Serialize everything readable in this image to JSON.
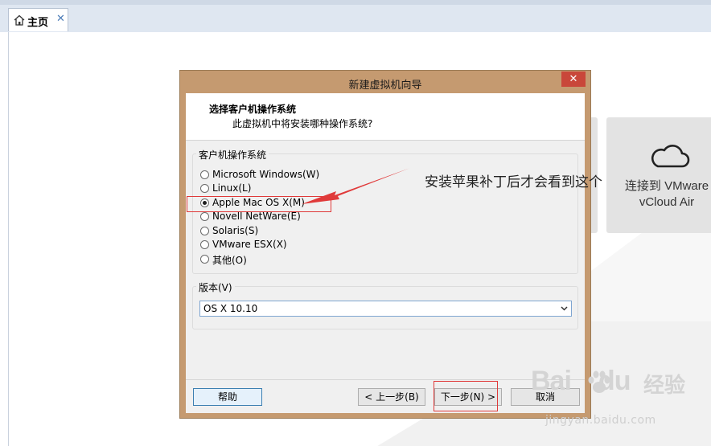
{
  "tab": {
    "label": "主页",
    "close_glyph": "✕",
    "icon": "home-icon"
  },
  "home": {
    "cloud_tile": {
      "icon": "cloud-icon",
      "line1": "连接到 VMware",
      "line2": "vCloud Air"
    }
  },
  "annotation": {
    "text": "安装苹果补丁后才会看到这个",
    "color": "#e03a3a"
  },
  "wizard": {
    "title": "新建虚拟机向导",
    "close_glyph": "✕",
    "header_title": "选择客户机操作系统",
    "header_subtitle": "此虚拟机中将安装哪种操作系统?",
    "os_group_label": "客户机操作系统",
    "os_options": [
      {
        "label": "Microsoft Windows(W)",
        "checked": false
      },
      {
        "label": "Linux(L)",
        "checked": false
      },
      {
        "label": "Apple Mac OS X(M)",
        "checked": true
      },
      {
        "label": "Novell NetWare(E)",
        "checked": false
      },
      {
        "label": "Solaris(S)",
        "checked": false
      },
      {
        "label": "VMware ESX(X)",
        "checked": false
      },
      {
        "label": "其他(O)",
        "checked": false
      }
    ],
    "version_label": "版本(V)",
    "version_value": "OS X 10.10",
    "buttons": {
      "help": "帮助",
      "back": "< 上一步(B)",
      "next": "下一步(N) >",
      "cancel": "取消"
    },
    "colors": {
      "frame": "#c59a70",
      "close": "#c9473a"
    }
  },
  "watermark": {
    "logo_left": "Bai",
    "logo_right": "du",
    "jingyan": "经验",
    "url": "jingyan.baidu.com"
  }
}
